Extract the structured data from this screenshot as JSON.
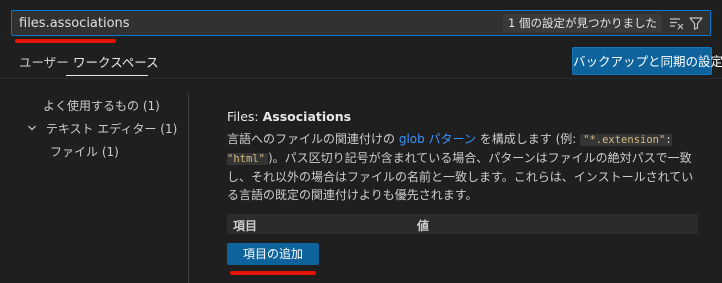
{
  "search": {
    "value": "files.associations",
    "result_text": "1 個の設定が見つかりました"
  },
  "icons": {
    "clear_filter": "clear-filter-icon",
    "filter": "filter-icon"
  },
  "tabs": [
    {
      "label": "ユーザー",
      "active": false
    },
    {
      "label": "ワークスペース",
      "active": true
    }
  ],
  "sync_button": "バックアップと同期の設定",
  "outline": [
    {
      "label": "よく使用するもの (1)"
    },
    {
      "label": "テキスト エディター (1)",
      "expanded": true
    },
    {
      "label": "ファイル (1)"
    }
  ],
  "setting": {
    "category": "Files: ",
    "name": "Associations",
    "desc_part1": "言語へのファイルの関連付けの ",
    "desc_link": "glob パターン",
    "desc_part2": " を構成します (例: ",
    "code_key": "\"*.extension\"",
    "code_colon": ": ",
    "code_value": "\"html\"",
    "desc_part3": ")。パス区切り記号が含まれている場合、パターンはファイルの絶対パスで一致し、それ以外の場合はファイルの名前と一致します。これらは、インストールされている言語の既定の関連付けよりも優先されます。",
    "table_headers": {
      "item": "項目",
      "value": "値"
    },
    "add_button": "項目の追加"
  },
  "colors": {
    "accent": "#0078d4",
    "button": "#0e639c",
    "annotation": "#e51400",
    "link": "#3794ff"
  }
}
